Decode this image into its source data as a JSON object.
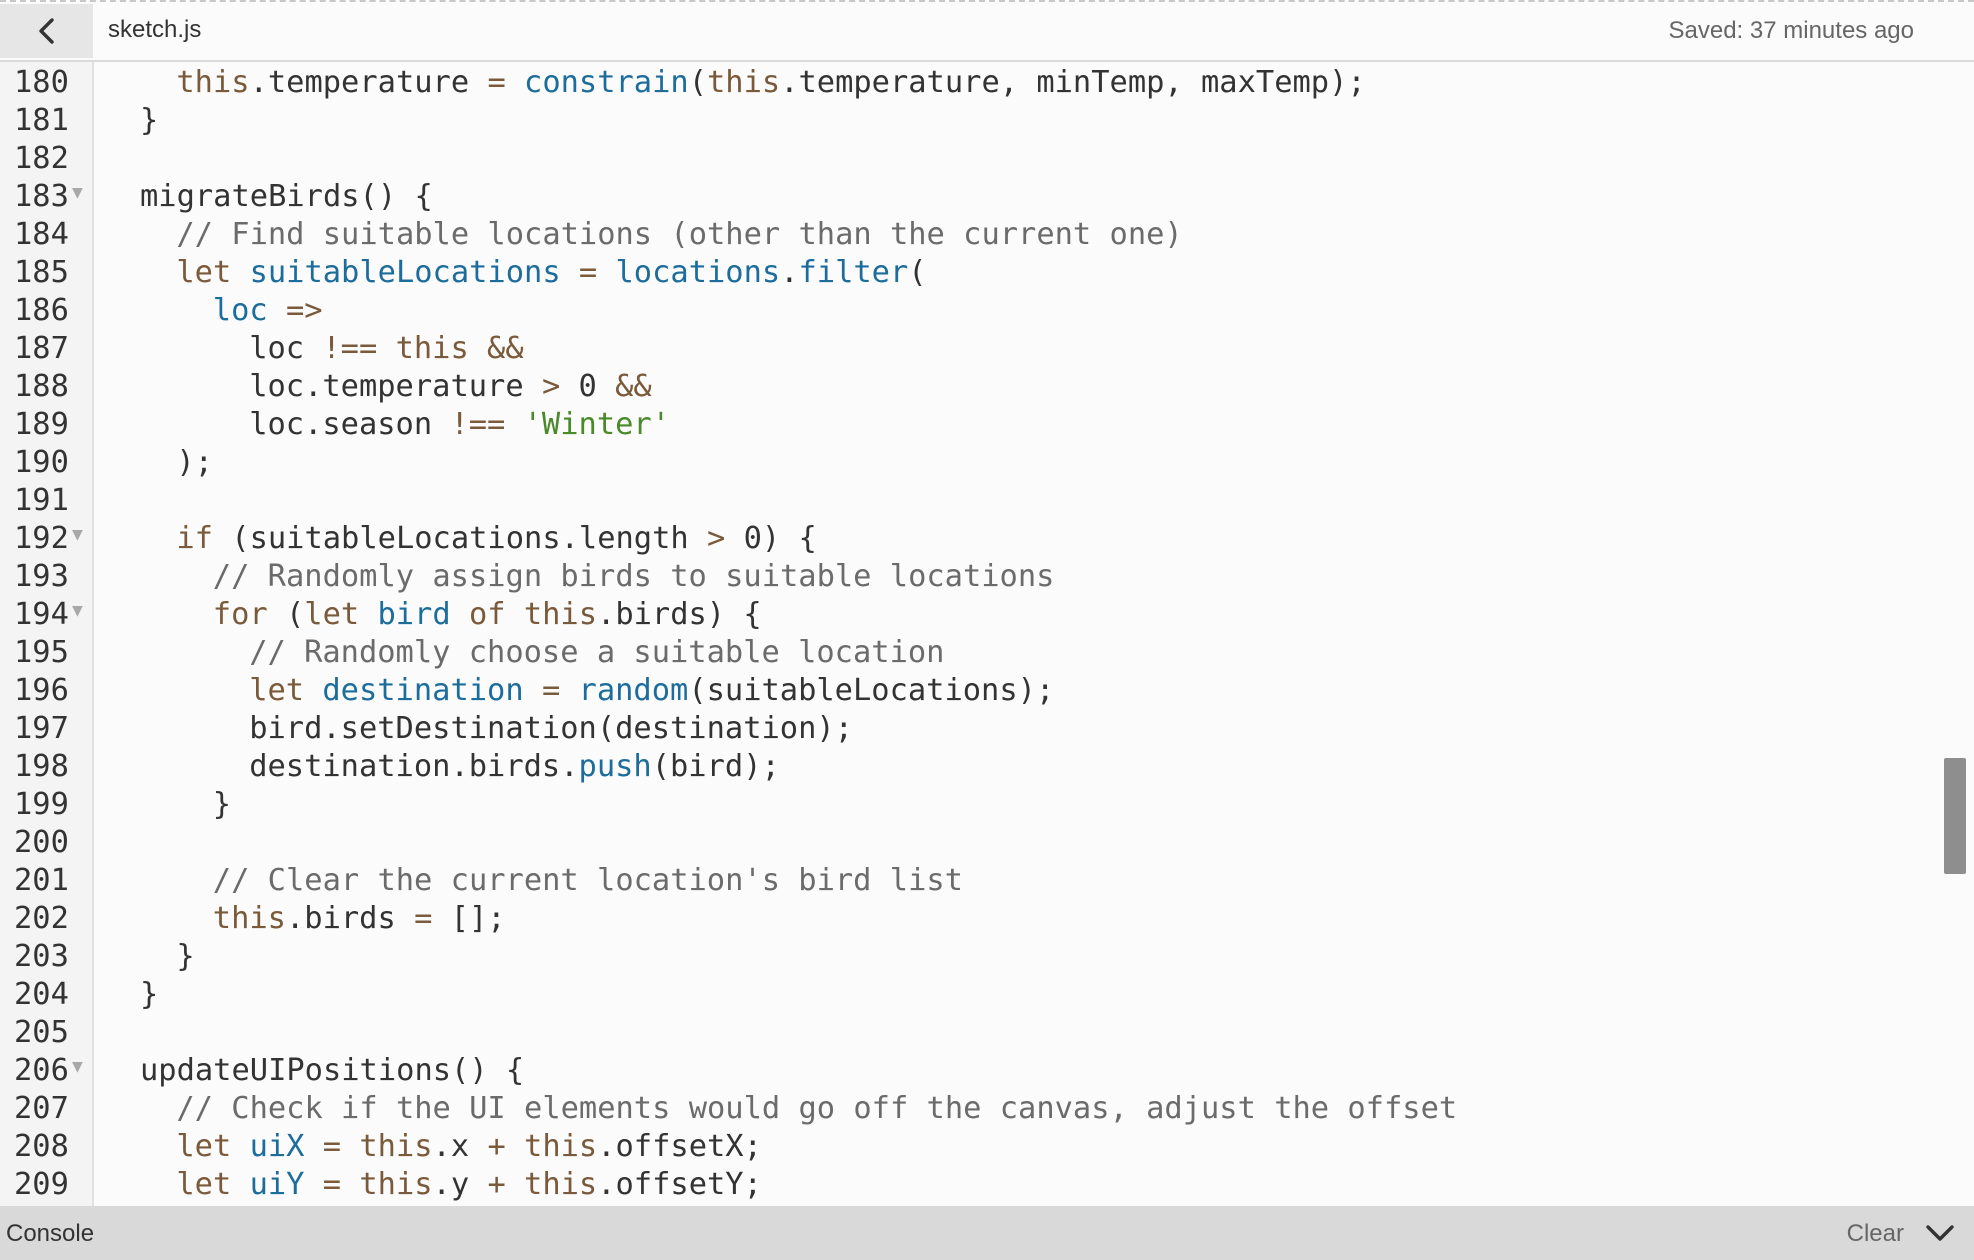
{
  "header": {
    "file_name": "sketch.js",
    "saved_status": "Saved: 37 minutes ago"
  },
  "editor": {
    "lines": [
      {
        "n": "180",
        "indent": 2,
        "fold": false,
        "tokens": [
          [
            "kw",
            "this"
          ],
          [
            "",
            "."
          ],
          [
            "",
            "temperature "
          ],
          [
            "op",
            "="
          ],
          [
            "",
            ""
          ],
          [
            "fn",
            " constrain"
          ],
          [
            "",
            "("
          ],
          [
            "kw",
            "this"
          ],
          [
            "",
            ".temperature, minTemp, maxTemp);"
          ]
        ]
      },
      {
        "n": "181",
        "indent": 1,
        "fold": false,
        "tokens": [
          [
            "",
            "}"
          ]
        ]
      },
      {
        "n": "182",
        "indent": 0,
        "fold": false,
        "tokens": []
      },
      {
        "n": "183",
        "indent": 1,
        "fold": true,
        "tokens": [
          [
            "",
            "migrateBirds() {"
          ]
        ]
      },
      {
        "n": "184",
        "indent": 2,
        "fold": false,
        "tokens": [
          [
            "cm",
            "// Find suitable locations (other than the current one)"
          ]
        ]
      },
      {
        "n": "185",
        "indent": 2,
        "fold": false,
        "tokens": [
          [
            "kw",
            "let"
          ],
          [
            "fn",
            " suitableLocations"
          ],
          [
            "",
            " "
          ],
          [
            "op",
            "="
          ],
          [
            "fn",
            " locations"
          ],
          [
            "",
            "."
          ],
          [
            "fn",
            "filter"
          ],
          [
            "",
            "("
          ]
        ]
      },
      {
        "n": "186",
        "indent": 3,
        "fold": false,
        "tokens": [
          [
            "fn",
            "loc"
          ],
          [
            "",
            " "
          ],
          [
            "op",
            "=>"
          ]
        ]
      },
      {
        "n": "187",
        "indent": 4,
        "fold": false,
        "tokens": [
          [
            "",
            "loc "
          ],
          [
            "op",
            "!=="
          ],
          [
            "",
            " "
          ],
          [
            "kw",
            "this"
          ],
          [
            "",
            " "
          ],
          [
            "op",
            "&&"
          ]
        ]
      },
      {
        "n": "188",
        "indent": 4,
        "fold": false,
        "tokens": [
          [
            "",
            "loc.temperature "
          ],
          [
            "op",
            ">"
          ],
          [
            "",
            " 0 "
          ],
          [
            "op",
            "&&"
          ]
        ]
      },
      {
        "n": "189",
        "indent": 4,
        "fold": false,
        "tokens": [
          [
            "",
            "loc.season "
          ],
          [
            "op",
            "!=="
          ],
          [
            "",
            " "
          ],
          [
            "str",
            "'Winter'"
          ]
        ]
      },
      {
        "n": "190",
        "indent": 2,
        "fold": false,
        "tokens": [
          [
            "",
            ");"
          ]
        ]
      },
      {
        "n": "191",
        "indent": 0,
        "fold": false,
        "tokens": []
      },
      {
        "n": "192",
        "indent": 2,
        "fold": true,
        "tokens": [
          [
            "kw",
            "if"
          ],
          [
            "",
            " (suitableLocations.length "
          ],
          [
            "op",
            ">"
          ],
          [
            "",
            " 0) {"
          ]
        ]
      },
      {
        "n": "193",
        "indent": 3,
        "fold": false,
        "tokens": [
          [
            "cm",
            "// Randomly assign birds to suitable locations"
          ]
        ]
      },
      {
        "n": "194",
        "indent": 3,
        "fold": true,
        "tokens": [
          [
            "kw",
            "for"
          ],
          [
            "",
            " ("
          ],
          [
            "kw",
            "let"
          ],
          [
            "fn",
            " bird"
          ],
          [
            "",
            " "
          ],
          [
            "kw",
            "of"
          ],
          [
            "",
            " "
          ],
          [
            "kw",
            "this"
          ],
          [
            "",
            ".birds) {"
          ]
        ]
      },
      {
        "n": "195",
        "indent": 4,
        "fold": false,
        "tokens": [
          [
            "cm",
            "// Randomly choose a suitable location"
          ]
        ]
      },
      {
        "n": "196",
        "indent": 4,
        "fold": false,
        "tokens": [
          [
            "kw",
            "let"
          ],
          [
            "fn",
            " destination"
          ],
          [
            "",
            " "
          ],
          [
            "op",
            "="
          ],
          [
            "fn",
            " random"
          ],
          [
            "",
            "(suitableLocations);"
          ]
        ]
      },
      {
        "n": "197",
        "indent": 4,
        "fold": false,
        "tokens": [
          [
            "",
            "bird.setDestination(destination);"
          ]
        ]
      },
      {
        "n": "198",
        "indent": 4,
        "fold": false,
        "tokens": [
          [
            "",
            "destination.birds."
          ],
          [
            "fn",
            "push"
          ],
          [
            "",
            "(bird);"
          ]
        ]
      },
      {
        "n": "199",
        "indent": 3,
        "fold": false,
        "tokens": [
          [
            "",
            "}"
          ]
        ]
      },
      {
        "n": "200",
        "indent": 0,
        "fold": false,
        "tokens": []
      },
      {
        "n": "201",
        "indent": 3,
        "fold": false,
        "tokens": [
          [
            "cm",
            "// Clear the current location's bird list"
          ]
        ]
      },
      {
        "n": "202",
        "indent": 3,
        "fold": false,
        "tokens": [
          [
            "kw",
            "this"
          ],
          [
            "",
            ".birds "
          ],
          [
            "op",
            "="
          ],
          [
            "",
            " [];"
          ]
        ]
      },
      {
        "n": "203",
        "indent": 2,
        "fold": false,
        "tokens": [
          [
            "",
            "}"
          ]
        ]
      },
      {
        "n": "204",
        "indent": 1,
        "fold": false,
        "tokens": [
          [
            "",
            "}"
          ]
        ]
      },
      {
        "n": "205",
        "indent": 0,
        "fold": false,
        "tokens": []
      },
      {
        "n": "206",
        "indent": 1,
        "fold": true,
        "tokens": [
          [
            "",
            "updateUIPositions() {"
          ]
        ]
      },
      {
        "n": "207",
        "indent": 2,
        "fold": false,
        "tokens": [
          [
            "cm",
            "// Check if the UI elements would go off the canvas, adjust the offset"
          ]
        ]
      },
      {
        "n": "208",
        "indent": 2,
        "fold": false,
        "tokens": [
          [
            "kw",
            "let"
          ],
          [
            "fn",
            " uiX"
          ],
          [
            "",
            " "
          ],
          [
            "op",
            "="
          ],
          [
            "",
            " "
          ],
          [
            "kw",
            "this"
          ],
          [
            "",
            ".x "
          ],
          [
            "op",
            "+"
          ],
          [
            "",
            " "
          ],
          [
            "kw",
            "this"
          ],
          [
            "",
            ".offsetX;"
          ]
        ]
      },
      {
        "n": "209",
        "indent": 2,
        "fold": false,
        "tokens": [
          [
            "kw",
            "let"
          ],
          [
            "fn",
            " uiY"
          ],
          [
            "",
            " "
          ],
          [
            "op",
            "="
          ],
          [
            "",
            " "
          ],
          [
            "kw",
            "this"
          ],
          [
            "",
            ".y "
          ],
          [
            "op",
            "+"
          ],
          [
            "",
            " "
          ],
          [
            "kw",
            "this"
          ],
          [
            "",
            ".offsetY;"
          ]
        ]
      }
    ]
  },
  "console": {
    "title": "Console",
    "clear_label": "Clear"
  },
  "icons": {
    "back": "chevron-left-icon",
    "fold": "fold-triangle-icon",
    "collapse": "chevron-down-icon"
  }
}
